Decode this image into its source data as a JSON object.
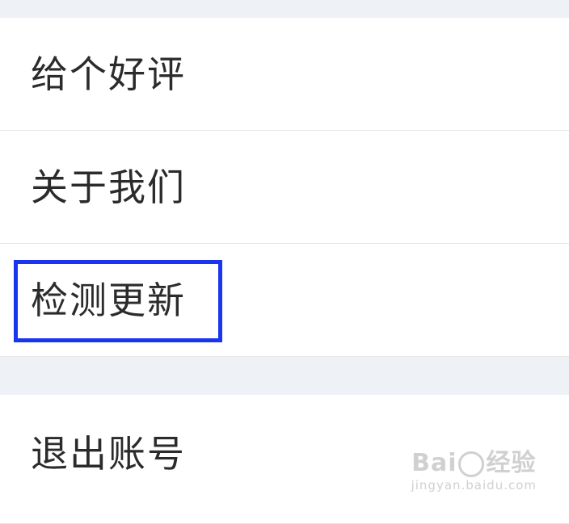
{
  "settings": {
    "items": [
      {
        "label": "给个好评"
      },
      {
        "label": "关于我们"
      },
      {
        "label": "检测更新"
      }
    ],
    "logout": {
      "label": "退出账号"
    }
  },
  "watermark": {
    "brand_left": "Bai",
    "brand_right": "经验",
    "url": "jingyan.baidu.com"
  },
  "colors": {
    "highlight": "#1a35f0",
    "section_gap": "#eef1f6",
    "row_bg": "#ffffff",
    "text": "#2b2b2b"
  }
}
